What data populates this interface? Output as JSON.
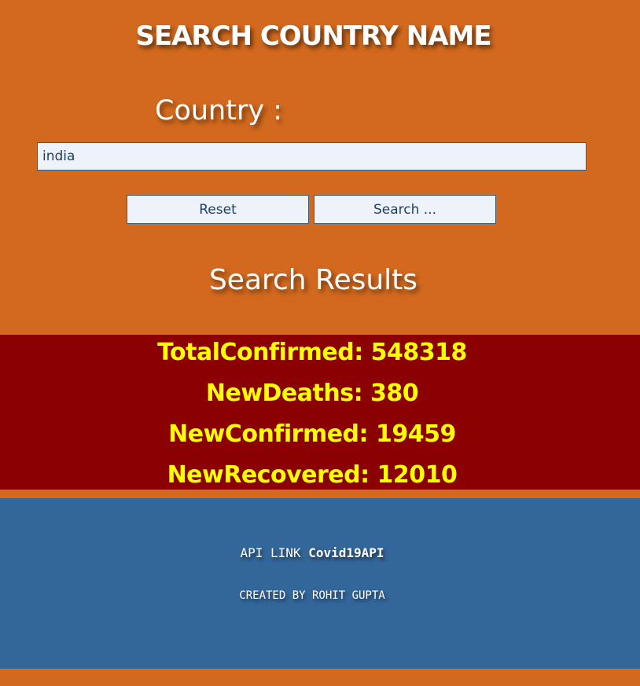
{
  "header": {
    "title": "SEARCH COUNTRY NAME"
  },
  "search": {
    "label": "Country :",
    "value": "india",
    "reset_label": "Reset",
    "search_label": "Search ..."
  },
  "results": {
    "title": "Search Results",
    "lines": [
      "TotalConfirmed: 548318",
      "NewDeaths: 380",
      "NewConfirmed: 19459",
      "NewRecovered: 12010"
    ]
  },
  "footer": {
    "api_prefix": "API LINK",
    "api_link_text": "Covid19API",
    "credit": "CREATED BY ROHIT GUPTA"
  },
  "colors": {
    "page_background": "#d2691e",
    "results_background": "#8b0000",
    "results_text": "#ffff00",
    "footer_background": "#336699"
  }
}
